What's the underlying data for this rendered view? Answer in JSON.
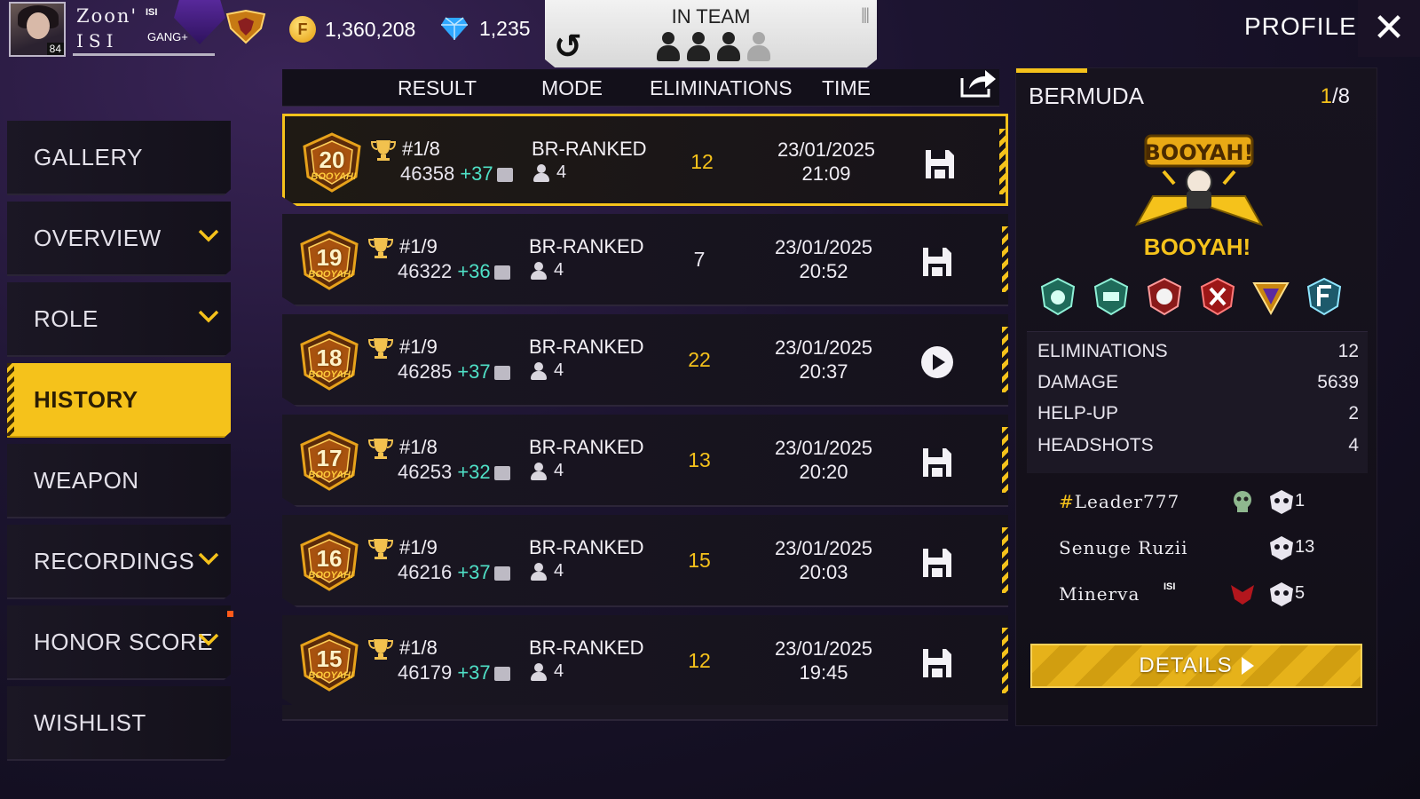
{
  "player": {
    "name_line1": "Zoon'",
    "name_line2": "ISI",
    "tag": "ISI",
    "guild": "GANG",
    "level": "84"
  },
  "currency": {
    "gold": "1,360,208",
    "gold_symbol": "F",
    "diamonds": "1,235"
  },
  "team_status": {
    "label": "IN TEAM",
    "members_total": 4,
    "members_present": 3
  },
  "header": {
    "profile_label": "PROFILE"
  },
  "sidebar": {
    "items": [
      {
        "label": "GALLERY",
        "dropdown": false,
        "active": false
      },
      {
        "label": "OVERVIEW",
        "dropdown": true,
        "active": false
      },
      {
        "label": "ROLE",
        "dropdown": true,
        "active": false
      },
      {
        "label": "HISTORY",
        "dropdown": false,
        "active": true
      },
      {
        "label": "WEAPON",
        "dropdown": false,
        "active": false
      },
      {
        "label": "RECORDINGS",
        "dropdown": true,
        "active": false
      },
      {
        "label": "HONOR SCORE",
        "dropdown": true,
        "active": false
      },
      {
        "label": "WISHLIST",
        "dropdown": false,
        "active": false
      }
    ]
  },
  "table": {
    "columns": {
      "result": "RESULT",
      "mode": "MODE",
      "eliminations": "ELIMINATIONS",
      "time": "TIME"
    },
    "rows": [
      {
        "medal": "20",
        "medal_label": "BOOYAH!",
        "rank": "#1/8",
        "score": "46358",
        "delta": "+37",
        "mode": "BR-RANKED",
        "party": "4",
        "eliminations": "12",
        "date": "23/01/2025",
        "time": "21:09",
        "icon": "save-icon",
        "selected": true
      },
      {
        "medal": "19",
        "medal_label": "BOOYAH!",
        "rank": "#1/9",
        "score": "46322",
        "delta": "+36",
        "mode": "BR-RANKED",
        "party": "4",
        "eliminations": "7",
        "date": "23/01/2025",
        "time": "20:52",
        "icon": "save-icon",
        "selected": false
      },
      {
        "medal": "18",
        "medal_label": "BOOYAH!",
        "rank": "#1/9",
        "score": "46285",
        "delta": "+37",
        "mode": "BR-RANKED",
        "party": "4",
        "eliminations": "22",
        "date": "23/01/2025",
        "time": "20:37",
        "icon": "play-icon",
        "selected": false
      },
      {
        "medal": "17",
        "medal_label": "BOOYAH!",
        "rank": "#1/8",
        "score": "46253",
        "delta": "+32",
        "mode": "BR-RANKED",
        "party": "4",
        "eliminations": "13",
        "date": "23/01/2025",
        "time": "20:20",
        "icon": "save-icon",
        "selected": false
      },
      {
        "medal": "16",
        "medal_label": "BOOYAH!",
        "rank": "#1/9",
        "score": "46216",
        "delta": "+37",
        "mode": "BR-RANKED",
        "party": "4",
        "eliminations": "15",
        "date": "23/01/2025",
        "time": "20:03",
        "icon": "save-icon",
        "selected": false
      },
      {
        "medal": "15",
        "medal_label": "BOOYAH!",
        "rank": "#1/8",
        "score": "46179",
        "delta": "+37",
        "mode": "BR-RANKED",
        "party": "4",
        "eliminations": "12",
        "date": "23/01/2025",
        "time": "19:45",
        "icon": "save-icon",
        "selected": false
      }
    ]
  },
  "match_detail": {
    "map": "BERMUDA",
    "placement": "1",
    "placement_total": "/8",
    "result_label": "BOOYAH!",
    "art_text": "BOOYAH!",
    "stats": [
      {
        "label": "ELIMINATIONS",
        "value": "12"
      },
      {
        "label": "DAMAGE",
        "value": "5639"
      },
      {
        "label": "HELP-UP",
        "value": "2"
      },
      {
        "label": "HEADSHOTS",
        "value": "4"
      }
    ],
    "teammates": [
      {
        "hash": "#",
        "name": "Leader777",
        "tag": "",
        "kills": "1"
      },
      {
        "hash": "",
        "name": "Senuge  Ruzii",
        "tag": "",
        "kills": "13"
      },
      {
        "hash": "",
        "name": "Minerva",
        "tag": "ISI",
        "kills": "5"
      }
    ],
    "details_label": "DETAILS"
  },
  "colors": {
    "accent": "#f5c21b",
    "plus": "#4fe0c6",
    "background": "#15121c"
  }
}
